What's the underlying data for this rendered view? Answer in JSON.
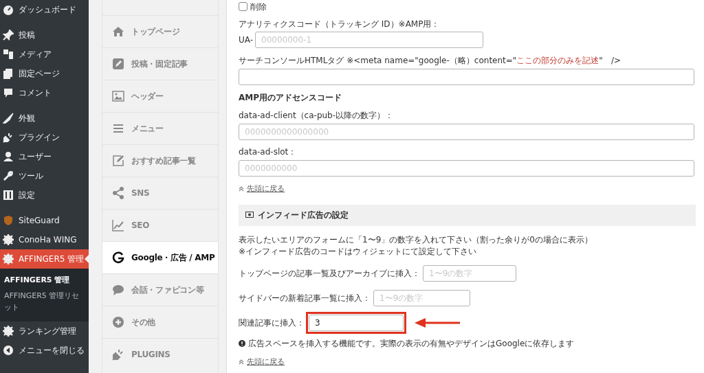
{
  "sidebar": {
    "items": [
      {
        "label": "ダッシュボード",
        "selected": false
      },
      {
        "label": "投稿",
        "selected": false
      },
      {
        "label": "メディア",
        "selected": false
      },
      {
        "label": "固定ページ",
        "selected": false
      },
      {
        "label": "コメント",
        "selected": false
      },
      {
        "label": "外観",
        "selected": false
      },
      {
        "label": "プラグイン",
        "selected": false
      },
      {
        "label": "ユーザー",
        "selected": false
      },
      {
        "label": "ツール",
        "selected": false
      },
      {
        "label": "設定",
        "selected": false
      },
      {
        "label": "SiteGuard",
        "selected": false
      },
      {
        "label": "ConoHa WING",
        "selected": false
      },
      {
        "label": "AFFINGER5 管理",
        "selected": true,
        "children": [
          {
            "label": "AFFINGER5 管理",
            "selected": true
          },
          {
            "label": "AFFINGER5 管理リセット",
            "selected": false
          }
        ]
      },
      {
        "label": "ランキング管理",
        "selected": false
      },
      {
        "label": "メニューを閉じる",
        "selected": false
      }
    ]
  },
  "tabs": [
    {
      "label": "トップページ",
      "selected": false
    },
    {
      "label": "投稿・固定記事",
      "selected": false
    },
    {
      "label": "ヘッダー",
      "selected": false
    },
    {
      "label": "メニュー",
      "selected": false
    },
    {
      "label": "おすすめ記事一覧",
      "selected": false
    },
    {
      "label": "SNS",
      "selected": false
    },
    {
      "label": "SEO",
      "selected": false
    },
    {
      "label": "Google・広告 / AMP",
      "selected": true
    },
    {
      "label": "会話・ファビコン等",
      "selected": false
    },
    {
      "label": "その他",
      "selected": false
    },
    {
      "label": "PLUGINS",
      "selected": false
    }
  ],
  "form": {
    "items": [
      {
        "kind": "checkbox",
        "label": "削除",
        "checked": false
      },
      {
        "kind": "label",
        "text": "アナリティクスコード（トラッキング ID）※AMP用："
      },
      {
        "kind": "prefixed_input",
        "prefix": "UA-",
        "placeholder": "00000000-1"
      },
      {
        "kind": "highlight_label",
        "before": "サーチコンソールHTMLタグ ※<meta name=\"google-（略）content=\"",
        "highlight": "ここの部分のみを記述",
        "after": "\"　/>"
      },
      {
        "kind": "wide_input"
      },
      {
        "kind": "heading",
        "text": "AMP用のアドセンスコード"
      },
      {
        "kind": "label",
        "text": "data-ad-client（ca-pub-以降の数字）："
      },
      {
        "kind": "wide_input",
        "placeholder": "0000000000000000"
      },
      {
        "kind": "label",
        "text": "data-ad-slot："
      },
      {
        "kind": "wide_input",
        "placeholder": "0000000000"
      },
      {
        "kind": "link",
        "text": "先頭に戻る"
      },
      {
        "kind": "section",
        "text": "インフィード広告の設定"
      },
      {
        "kind": "paragraph",
        "lines": [
          "表示したいエリアのフォームに「1〜9」の数字を入れて下さい（割った余りが0の場合に表示）",
          "※インフィード広告のコードはウィジェットにて設定して下さい"
        ]
      },
      {
        "kind": "inline_input",
        "label": "トップページの記事一覧及びアーカイブに挿入：",
        "placeholder": "1〜9の数字",
        "highlighted": false
      },
      {
        "kind": "inline_input",
        "label": "サイドバーの新着記事一覧に挿入：",
        "placeholder": "1〜9の数字",
        "highlighted": false
      },
      {
        "kind": "inline_input",
        "label": "関連記事に挿入：",
        "value": "3",
        "highlighted": true
      },
      {
        "kind": "note",
        "text": "広告スペースを挿入する機能です。実際の表示の有無やデザインはGoogleに依存します"
      },
      {
        "kind": "link",
        "text": "先頭に戻る"
      }
    ]
  }
}
